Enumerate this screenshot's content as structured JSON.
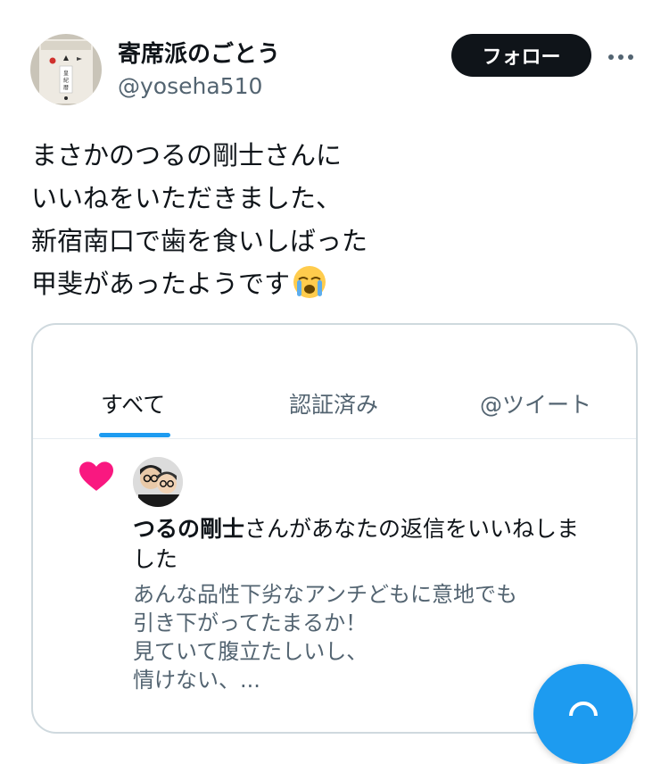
{
  "profile": {
    "display_name": "寄席派のごとう",
    "handle": "@yoseha510",
    "avatar_caption": "皇紀暦"
  },
  "header": {
    "follow_label": "フォロー",
    "more_icon": "more-horizontal-icon"
  },
  "tweet": {
    "lines": [
      "まさかのつるの剛士さんに",
      "いいねをいただきました、",
      "新宿南口で歯を食いしばった",
      "甲斐があったようです"
    ],
    "emoji": "loudly-crying-face-icon"
  },
  "embed": {
    "tabs": [
      {
        "label": "すべて",
        "active": true
      },
      {
        "label": "認証済み",
        "active": false
      },
      {
        "label": "@ツイート",
        "active": false
      }
    ],
    "notification": {
      "actor": "つるの剛士",
      "message_rest": "さんがあなたの返信をいいねしま",
      "message_line2": "した",
      "quoted_lines": [
        "あんな品性下劣なアンチどもに意地でも",
        "引き下がってたまるか！",
        "見ていて腹立たしいし、",
        "情けない、..."
      ]
    }
  },
  "colors": {
    "accent": "#1d9bf0",
    "like": "#f91880",
    "text_primary": "#0f1419",
    "text_secondary": "#536471",
    "border": "#cfd9de"
  }
}
